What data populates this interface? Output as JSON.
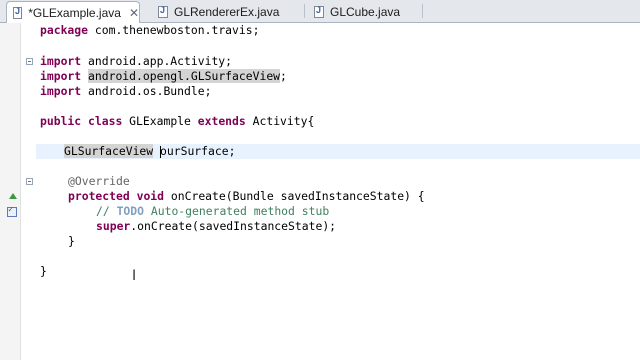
{
  "tabs": [
    {
      "label": "*GLExample.java",
      "active": true,
      "close": "✕"
    },
    {
      "label": "GLRendererEx.java",
      "active": false
    },
    {
      "label": "GLCube.java",
      "active": false
    }
  ],
  "code": {
    "line1": {
      "kw": "package",
      "rest": " com.thenewboston.travis;"
    },
    "line2": {
      "kw": "import",
      "rest": " android.app.Activity;"
    },
    "line3": {
      "kw": "import",
      "pre": " ",
      "occ": "android.opengl.GLSurfaceView",
      "post": ";"
    },
    "line4": {
      "kw": "import",
      "rest": " android.os.Bundle;"
    },
    "line5": {
      "kw1": "public",
      "kw2": "class",
      "mid": " GLExample ",
      "kw3": "extends",
      "rest": " Activity{"
    },
    "line6": {
      "occ": "GLSurfaceView",
      "pre": " ",
      "first": "o",
      "rest": "urSurface;"
    },
    "line7": {
      "ann": "@Override"
    },
    "line8": {
      "kw1": "protected",
      "kw2": "void",
      "rest": " onCreate(Bundle savedInstanceState) {"
    },
    "line9": {
      "cmt1": "// ",
      "todo": "TODO",
      "cmt2": " Auto-generated method stub"
    },
    "line10": {
      "kw": "super",
      "rest": ".onCreate(savedInstanceState);"
    },
    "line11": {
      "text": "}"
    },
    "line12": {
      "text": "}"
    }
  },
  "colors": {
    "keyword": "#7f0055",
    "comment": "#3f7f5f",
    "annotation": "#646464",
    "current_line": "#e8f2fe",
    "occurrence": "#d4d4d4"
  },
  "icons": {
    "tab_file": "java-file-icon",
    "override_marker": "override-triangle-icon",
    "task_marker": "task-icon",
    "fold": "fold-minus-icon",
    "pointer": "i-beam-cursor-icon"
  }
}
